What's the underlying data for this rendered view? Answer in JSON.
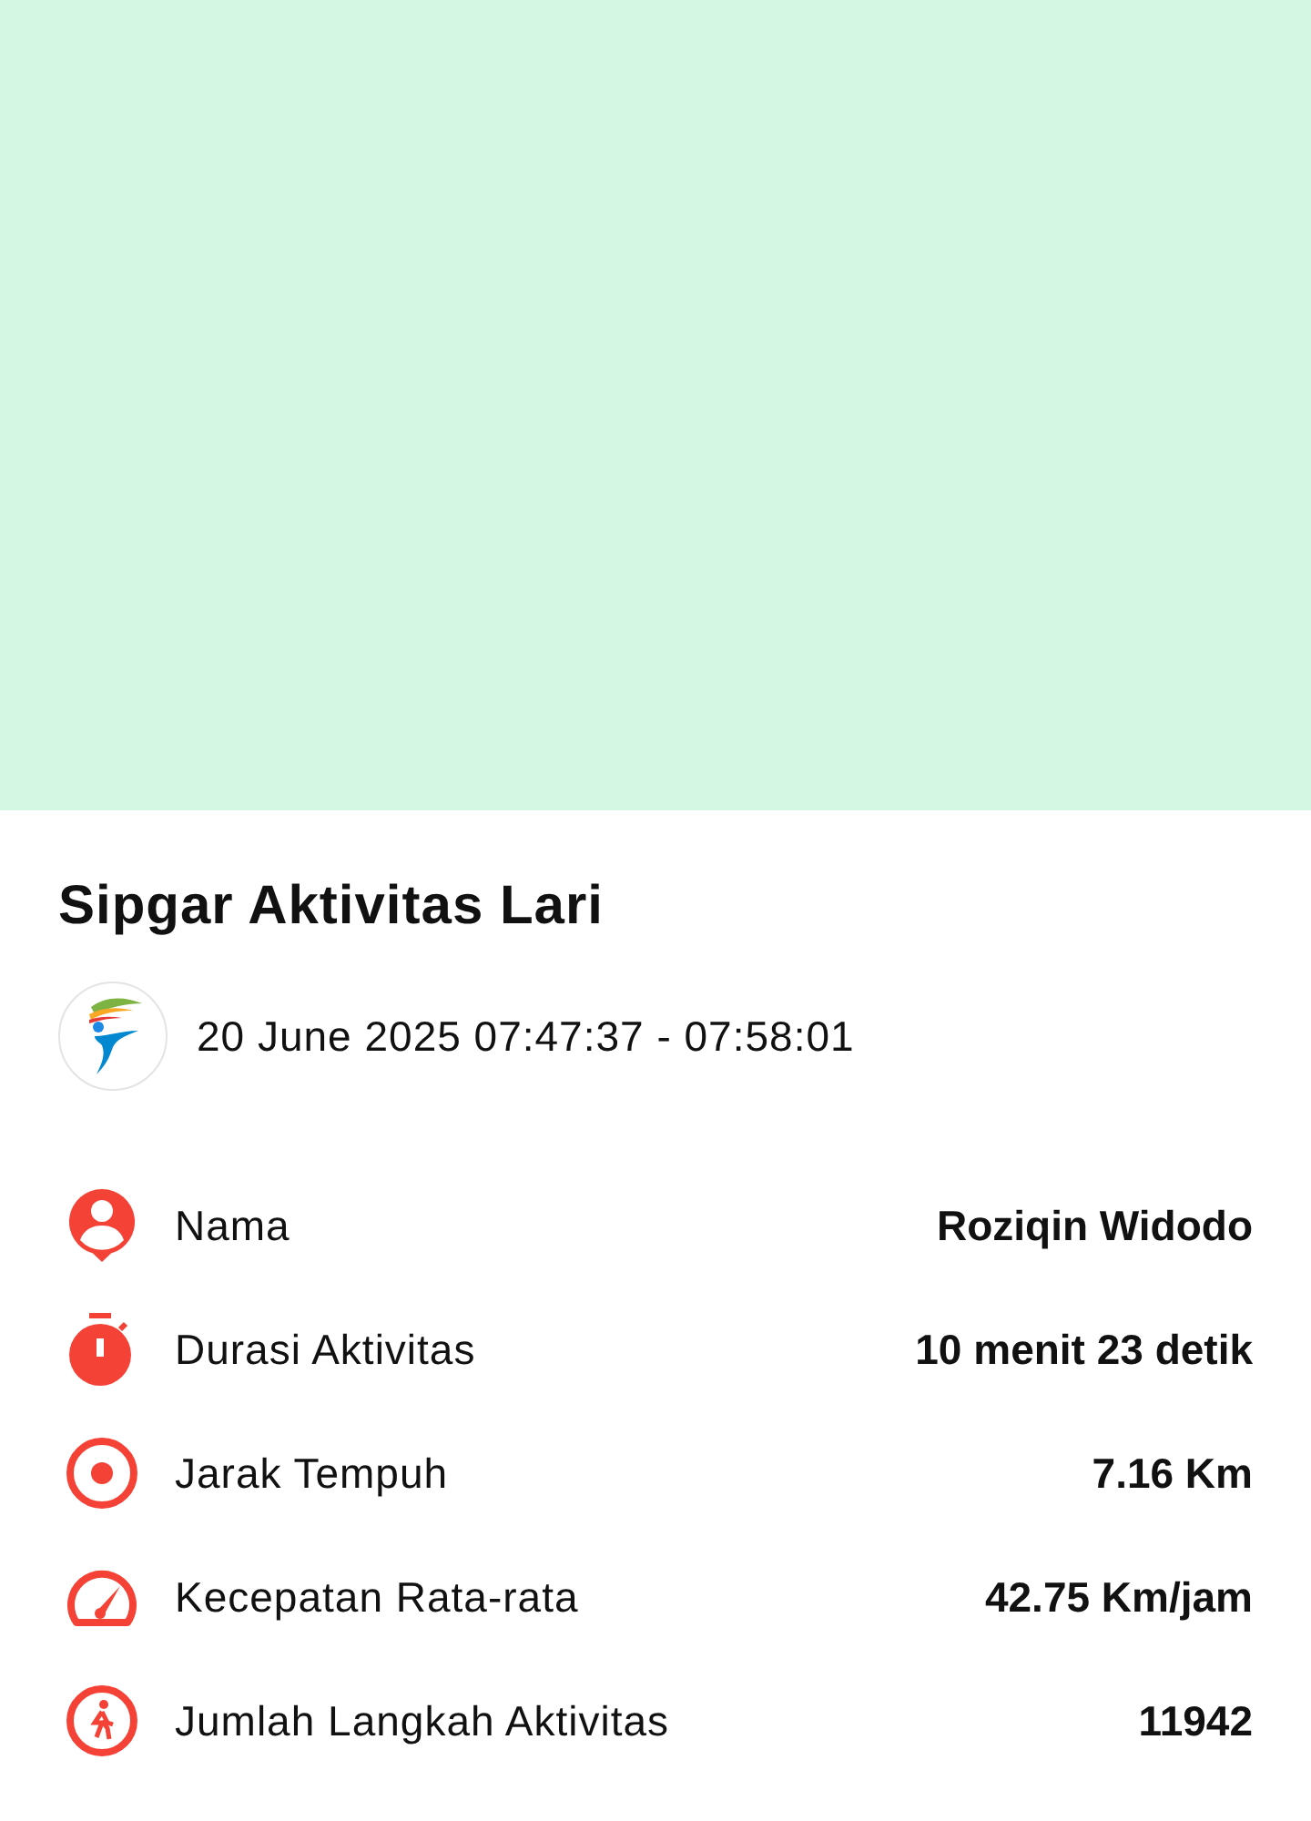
{
  "title": "Sipgar Aktivitas Lari",
  "date_range": "20 June 2025 07:47:37 - 07:58:01",
  "stats": [
    {
      "kind": "person",
      "label": "Nama",
      "value": "Roziqin Widodo"
    },
    {
      "kind": "timer",
      "label": "Durasi Aktivitas",
      "value": "10 menit 23 detik"
    },
    {
      "kind": "target",
      "label": "Jarak Tempuh",
      "value": "7.16 Km"
    },
    {
      "kind": "speed",
      "label": "Kecepatan Rata-rata",
      "value": "42.75 Km/jam"
    },
    {
      "kind": "steps",
      "label": "Jumlah Langkah Aktivitas",
      "value": "11942"
    }
  ]
}
